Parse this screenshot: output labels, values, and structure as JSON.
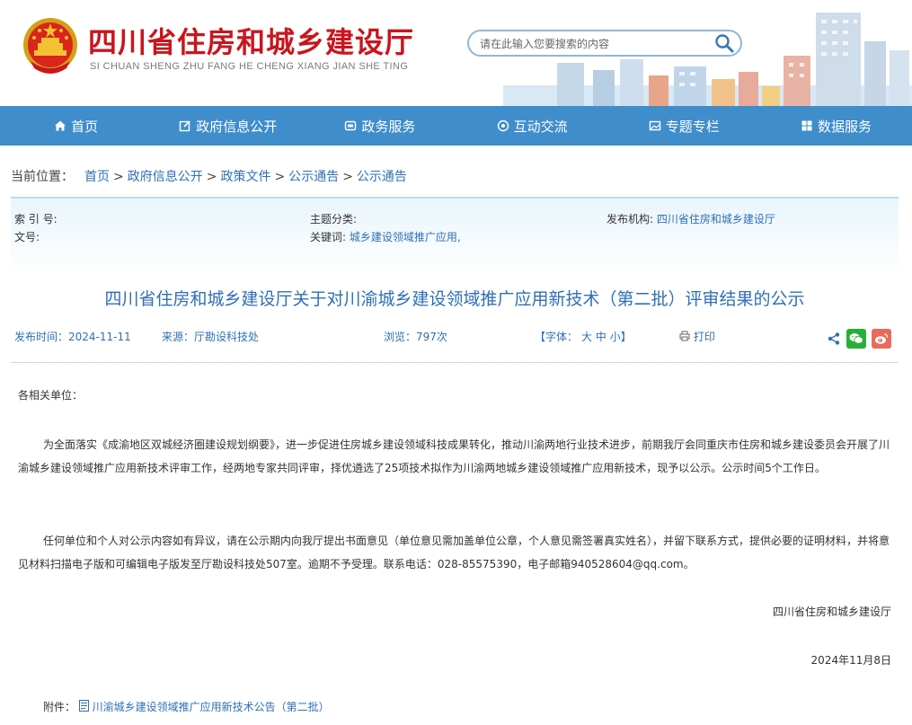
{
  "header": {
    "title": "四川省住房和城乡建设厅",
    "pinyin": "SI CHUAN SHENG ZHU FANG HE CHENG XIANG JIAN SHE TING",
    "search_placeholder": "请在此输入您要搜索的内容"
  },
  "nav": {
    "items": [
      {
        "label": "首页",
        "icon": "home-icon"
      },
      {
        "label": "政府信息公开",
        "icon": "edit-icon"
      },
      {
        "label": "政务服务",
        "icon": "service-icon"
      },
      {
        "label": "互动交流",
        "icon": "interact-icon"
      },
      {
        "label": "专题专栏",
        "icon": "image-icon"
      },
      {
        "label": "数据服务",
        "icon": "data-icon"
      }
    ]
  },
  "breadcrumb": {
    "label": "当前位置：",
    "items": [
      "首页",
      "政府信息公开",
      "政策文件",
      "公示通告",
      "公示通告"
    ],
    "separator": ">"
  },
  "meta": {
    "index_label": "索 引 号:",
    "index_value": "",
    "topic_label": "主题分类:",
    "topic_value": "",
    "org_label": "发布机构:",
    "org_value": "四川省住房和城乡建设厅",
    "docno_label": "文号:",
    "docno_value": "",
    "keywords_label": "关键词:",
    "keywords_value": "城乡建设领域推广应用,"
  },
  "article": {
    "title": "四川省住房和城乡建设厅关于对川渝城乡建设领域推广应用新技术（第二批）评审结果的公示",
    "publish_time": "发布时间：2024-11-11",
    "source": "来源：厅勘设科技处",
    "views": "浏览：797次",
    "font_label": "【字体：",
    "font_large": "大",
    "font_medium": "中",
    "font_small": "小",
    "font_close": "】",
    "print": "打印",
    "greeting": "各相关单位：",
    "para1": "为全面落实《成渝地区双城经济圈建设规划纲要》，进一步促进住房城乡建设领域科技成果转化，推动川渝两地行业技术进步，前期我厅会同重庆市住房和城乡建设委员会开展了川渝城乡建设领域推广应用新技术评审工作，经两地专家共同评审，择优遴选了25项技术拟作为川渝两地城乡建设领域推广应用新技术，现予以公示。公示时间5个工作日。",
    "para2": "任何单位和个人对公示内容如有异议，请在公示期内向我厅提出书面意见（单位意见需加盖单位公章，个人意见需签署真实姓名），并留下联系方式，提供必要的证明材料，并将意见材料扫描电子版和可编辑电子版发至厅勘设科技处507室。逾期不予受理。联系电话：028-85575390，电子邮箱940528604@qq.com。",
    "signature": "四川省住房和城乡建设厅",
    "date": "2024年11月8日",
    "attachment_label": "附件：",
    "attachment_link": "川渝城乡建设领域推广应用新技术公告（第二批）"
  },
  "colors": {
    "nav_bg": "#3f8dcb",
    "title_red": "#c8161d",
    "link_blue": "#2f6fb5",
    "wechat_green": "#2aae3a",
    "weibo_red": "#e96b5c"
  }
}
